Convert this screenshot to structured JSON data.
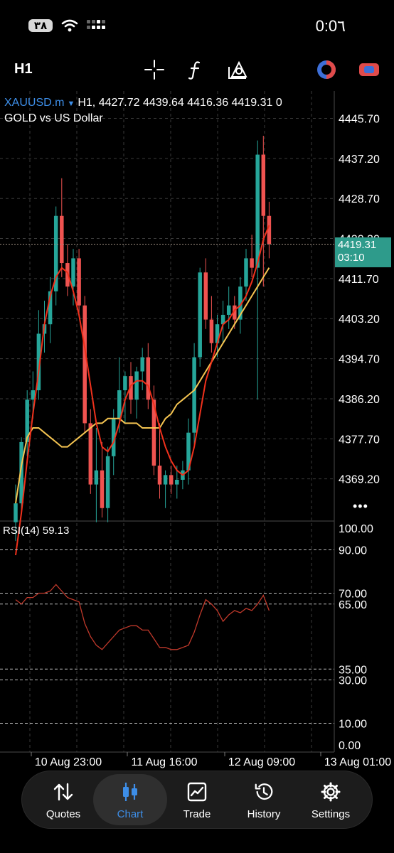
{
  "status": {
    "battery": "٣٨",
    "time": "0:0٦"
  },
  "toolbar": {
    "timeframe": "H1"
  },
  "chart_header": {
    "symbol": "XAUUSD.m",
    "ohlc": "H1, 4427.72 4439.64 4416.36 4419.31 0",
    "description": "GOLD vs US Dollar"
  },
  "current_price": {
    "price": "4419.31",
    "countdown": "03:10"
  },
  "rsi": {
    "label": "RSI(14) 59.13"
  },
  "colors": {
    "bull": "#26a69a",
    "bear": "#ef5350",
    "ma_fast": "#f0311c",
    "ma_slow": "#f5c451",
    "rsi": "#c0392b",
    "accent": "#3d8ee8"
  },
  "chart_data": [
    {
      "type": "candlestick",
      "title": "XAUUSD.m",
      "ylim": [
        4361,
        4450
      ],
      "y_ticks": [
        "4445.70",
        "4437.20",
        "4428.70",
        "4420.20",
        "4411.70",
        "4403.20",
        "4394.70",
        "4386.20",
        "4377.70",
        "4369.20"
      ],
      "x_ticks": [
        "10 Aug 23:00",
        "11 Aug 16:00",
        "12 Aug 09:00",
        "13 Aug 01:00"
      ],
      "candles": [
        {
          "o": 4360,
          "h": 4368,
          "l": 4356,
          "c": 4364
        },
        {
          "o": 4364,
          "h": 4378,
          "l": 4362,
          "c": 4377
        },
        {
          "o": 4377,
          "h": 4388,
          "l": 4374,
          "c": 4386
        },
        {
          "o": 4386,
          "h": 4392,
          "l": 4382,
          "c": 4388
        },
        {
          "o": 4388,
          "h": 4405,
          "l": 4386,
          "c": 4400
        },
        {
          "o": 4400,
          "h": 4407,
          "l": 4396,
          "c": 4402
        },
        {
          "o": 4402,
          "h": 4412,
          "l": 4398,
          "c": 4409
        },
        {
          "o": 4409,
          "h": 4427,
          "l": 4406,
          "c": 4425
        },
        {
          "o": 4425,
          "h": 4433,
          "l": 4412,
          "c": 4415
        },
        {
          "o": 4415,
          "h": 4419,
          "l": 4408,
          "c": 4410
        },
        {
          "o": 4410,
          "h": 4418,
          "l": 4406,
          "c": 4416
        },
        {
          "o": 4416,
          "h": 4418,
          "l": 4404,
          "c": 4406
        },
        {
          "o": 4406,
          "h": 4408,
          "l": 4379,
          "c": 4381
        },
        {
          "o": 4381,
          "h": 4384,
          "l": 4366,
          "c": 4368
        },
        {
          "o": 4368,
          "h": 4380,
          "l": 4360,
          "c": 4371
        },
        {
          "o": 4371,
          "h": 4377,
          "l": 4361,
          "c": 4363
        },
        {
          "o": 4363,
          "h": 4376,
          "l": 4360,
          "c": 4374
        },
        {
          "o": 4374,
          "h": 4384,
          "l": 4370,
          "c": 4382
        },
        {
          "o": 4382,
          "h": 4395,
          "l": 4379,
          "c": 4388
        },
        {
          "o": 4388,
          "h": 4392,
          "l": 4381,
          "c": 4391
        },
        {
          "o": 4391,
          "h": 4394,
          "l": 4383,
          "c": 4386
        },
        {
          "o": 4386,
          "h": 4393,
          "l": 4382,
          "c": 4392
        },
        {
          "o": 4392,
          "h": 4397,
          "l": 4388,
          "c": 4395
        },
        {
          "o": 4395,
          "h": 4398,
          "l": 4384,
          "c": 4386
        },
        {
          "o": 4386,
          "h": 4389,
          "l": 4370,
          "c": 4372
        },
        {
          "o": 4372,
          "h": 4381,
          "l": 4365,
          "c": 4368
        },
        {
          "o": 4368,
          "h": 4371,
          "l": 4363,
          "c": 4370
        },
        {
          "o": 4370,
          "h": 4372,
          "l": 4366,
          "c": 4368
        },
        {
          "o": 4368,
          "h": 4372,
          "l": 4365,
          "c": 4369
        },
        {
          "o": 4369,
          "h": 4373,
          "l": 4367,
          "c": 4371
        },
        {
          "o": 4371,
          "h": 4382,
          "l": 4368,
          "c": 4379
        },
        {
          "o": 4379,
          "h": 4398,
          "l": 4376,
          "c": 4395
        },
        {
          "o": 4395,
          "h": 4414,
          "l": 4393,
          "c": 4413
        },
        {
          "o": 4413,
          "h": 4416,
          "l": 4401,
          "c": 4403
        },
        {
          "o": 4403,
          "h": 4408,
          "l": 4396,
          "c": 4398
        },
        {
          "o": 4398,
          "h": 4404,
          "l": 4395,
          "c": 4402
        },
        {
          "o": 4402,
          "h": 4407,
          "l": 4398,
          "c": 4404
        },
        {
          "o": 4404,
          "h": 4410,
          "l": 4401,
          "c": 4406
        },
        {
          "o": 4406,
          "h": 4408,
          "l": 4401,
          "c": 4403
        },
        {
          "o": 4403,
          "h": 4412,
          "l": 4400,
          "c": 4410
        },
        {
          "o": 4410,
          "h": 4418,
          "l": 4407,
          "c": 4416
        },
        {
          "o": 4416,
          "h": 4421,
          "l": 4412,
          "c": 4414
        },
        {
          "o": 4414,
          "h": 4441,
          "l": 4386,
          "c": 4438
        },
        {
          "o": 4438,
          "h": 4442,
          "l": 4410,
          "c": 4425
        },
        {
          "o": 4425,
          "h": 4428,
          "l": 4416,
          "c": 4419
        }
      ],
      "ma_fast": [
        4353,
        4362,
        4373,
        4383,
        4392,
        4402,
        4408,
        4412,
        4414,
        4413,
        4409,
        4404,
        4397,
        4389,
        4381,
        4376,
        4375,
        4377,
        4381,
        4386,
        4389,
        4390,
        4390,
        4389,
        4385,
        4380,
        4376,
        4373,
        4371,
        4370,
        4371,
        4376,
        4383,
        4390,
        4394,
        4398,
        4402,
        4403,
        4405,
        4406,
        4408,
        4411,
        4415,
        4420,
        4423
      ],
      "ma_slow": [
        4364,
        4372,
        4378,
        4380,
        4380,
        4379,
        4378,
        4377,
        4376,
        4376,
        4377,
        4378,
        4379,
        4380,
        4381,
        4381,
        4382,
        4382,
        4382,
        4381,
        4381,
        4381,
        4380,
        4380,
        4380,
        4380,
        4382,
        4383,
        4385,
        4386,
        4387,
        4388,
        4390,
        4392,
        4394,
        4396,
        4398,
        4400,
        4402,
        4404,
        4406,
        4408,
        4410,
        4412,
        4414
      ]
    },
    {
      "type": "line",
      "title": "RSI(14) 59.13",
      "ylim": [
        0,
        100
      ],
      "y_ticks": [
        "100.00",
        "90.00",
        "70.00",
        "65.00",
        "35.00",
        "30.00",
        "10.00",
        "0.00"
      ],
      "values": [
        67,
        65,
        68,
        68,
        70,
        70,
        71,
        74,
        71,
        68,
        67,
        66,
        56,
        50,
        46,
        44,
        47,
        50,
        53,
        54,
        55,
        55,
        53,
        53,
        49,
        45,
        45,
        44,
        44,
        45,
        46,
        52,
        60,
        67,
        65,
        62,
        57,
        60,
        62,
        61,
        63,
        62,
        65,
        69,
        62
      ]
    }
  ],
  "tabs": [
    {
      "label": "Quotes",
      "icon": "quotes-arrows-icon"
    },
    {
      "label": "Chart",
      "icon": "candlestick-icon"
    },
    {
      "label": "Trade",
      "icon": "trade-chart-icon"
    },
    {
      "label": "History",
      "icon": "history-clock-icon"
    },
    {
      "label": "Settings",
      "icon": "gear-icon"
    }
  ]
}
